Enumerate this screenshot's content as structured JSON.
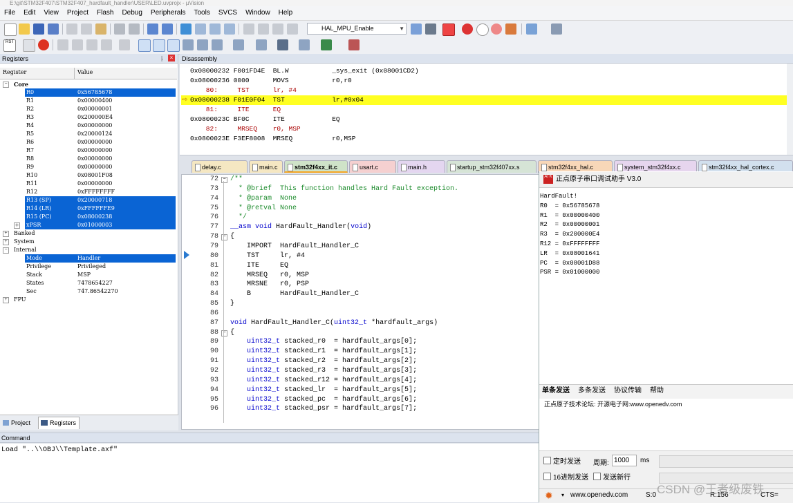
{
  "window": {
    "title": "E:\\git\\STM32F407\\STM32F407_hardfault_handler\\USER\\LED.uvprojx - µVision"
  },
  "menu": [
    "File",
    "Edit",
    "View",
    "Project",
    "Flash",
    "Debug",
    "Peripherals",
    "Tools",
    "SVCS",
    "Window",
    "Help"
  ],
  "toolbar": {
    "target": "HAL_MPU_Enable"
  },
  "registers": {
    "panel_title": "Registers",
    "col_register": "Register",
    "col_value": "Value",
    "core_label": "Core",
    "core": [
      {
        "name": "R0",
        "value": "0x56785678",
        "selected": true
      },
      {
        "name": "R1",
        "value": "0x00000400",
        "selected": false
      },
      {
        "name": "R2",
        "value": "0x00000001",
        "selected": false
      },
      {
        "name": "R3",
        "value": "0x200000E4",
        "selected": false
      },
      {
        "name": "R4",
        "value": "0x00000000",
        "selected": false
      },
      {
        "name": "R5",
        "value": "0x20000124",
        "selected": false
      },
      {
        "name": "R6",
        "value": "0x00000000",
        "selected": false
      },
      {
        "name": "R7",
        "value": "0x00000000",
        "selected": false
      },
      {
        "name": "R8",
        "value": "0x00000000",
        "selected": false
      },
      {
        "name": "R9",
        "value": "0x00000000",
        "selected": false
      },
      {
        "name": "R10",
        "value": "0x08001F08",
        "selected": false
      },
      {
        "name": "R11",
        "value": "0x00000000",
        "selected": false
      },
      {
        "name": "R12",
        "value": "0xFFFFFFFF",
        "selected": false
      },
      {
        "name": "R13 (SP)",
        "value": "0x20000718",
        "selected": true
      },
      {
        "name": "R14 (LR)",
        "value": "0xFFFFFFE9",
        "selected": true
      },
      {
        "name": "R15 (PC)",
        "value": "0x08000238",
        "selected": true
      },
      {
        "name": "xPSR",
        "value": "0x01000003",
        "selected": true
      }
    ],
    "banked_label": "Banked",
    "system_label": "System",
    "internal_label": "Internal",
    "internal": [
      {
        "name": "Mode",
        "value": "Handler",
        "selected": true
      },
      {
        "name": "Privilege",
        "value": "Privileged",
        "selected": false
      },
      {
        "name": "Stack",
        "value": "MSP",
        "selected": false
      },
      {
        "name": "States",
        "value": "7478654227",
        "selected": false
      },
      {
        "name": "Sec",
        "value": "747.86542270",
        "selected": false
      }
    ],
    "fpu_label": "FPU"
  },
  "disassembly": {
    "panel_title": "Disassembly",
    "lines": [
      {
        "text": "0x08000232 F001FD4E  BL.W           _sys_exit (0x08001CD2)",
        "type": "asm"
      },
      {
        "text": "0x08000236 0000      MOVS           r0,r0",
        "type": "asm"
      },
      {
        "text": "    80:     TST      lr, #4",
        "type": "src"
      },
      {
        "text": "0x08000238 F01E0F04  TST            lr,#0x04",
        "type": "cur"
      },
      {
        "text": "    81:     ITE      EQ",
        "type": "src"
      },
      {
        "text": "0x0800023C BF0C      ITE            EQ",
        "type": "asm"
      },
      {
        "text": "    82:     MRSEQ    r0, MSP",
        "type": "src"
      },
      {
        "text": "0x0800023E F3EF8008  MRSEQ          r0,MSP",
        "type": "asm"
      }
    ]
  },
  "tabs": [
    {
      "label": "delay.c",
      "color": "#f5e7c2"
    },
    {
      "label": "main.c",
      "color": "#f5e7c2"
    },
    {
      "label": "stm32f4xx_it.c",
      "color": "#cfe3c8",
      "active": true
    },
    {
      "label": "usart.c",
      "color": "#f5d0d0"
    },
    {
      "label": "main.h",
      "color": "#e4d6f0"
    },
    {
      "label": "startup_stm32f407xx.s",
      "color": "#d6e4d6"
    },
    {
      "label": "stm32f4xx_hal.c",
      "color": "#f8d7b8"
    },
    {
      "label": "system_stm32f4xx.c",
      "color": "#e6d5ee"
    },
    {
      "label": "stm32f4xx_hal_cortex.c",
      "color": "#d2e0ee"
    }
  ],
  "editor": {
    "lines": [
      {
        "n": "72",
        "code": "/**"
      },
      {
        "n": "73",
        "code": "  * @brief  This function handles Hard Fault exception."
      },
      {
        "n": "74",
        "code": "  * @param  None"
      },
      {
        "n": "75",
        "code": "  * @retval None"
      },
      {
        "n": "76",
        "code": "  */"
      },
      {
        "n": "77",
        "code": "__asm void HardFault_Handler(void)"
      },
      {
        "n": "78",
        "code": "{"
      },
      {
        "n": "79",
        "code": "    IMPORT  HardFault_Handler_C"
      },
      {
        "n": "80",
        "code": "    TST     lr, #4"
      },
      {
        "n": "81",
        "code": "    ITE     EQ"
      },
      {
        "n": "82",
        "code": "    MRSEQ   r0, MSP"
      },
      {
        "n": "83",
        "code": "    MRSNE   r0, PSP"
      },
      {
        "n": "84",
        "code": "    B       HardFault_Handler_C"
      },
      {
        "n": "85",
        "code": "}"
      },
      {
        "n": "86",
        "code": ""
      },
      {
        "n": "87",
        "code": "void HardFault_Handler_C(uint32_t *hardfault_args)"
      },
      {
        "n": "88",
        "code": "{"
      },
      {
        "n": "89",
        "code": "    uint32_t stacked_r0  = hardfault_args[0];"
      },
      {
        "n": "90",
        "code": "    uint32_t stacked_r1  = hardfault_args[1];"
      },
      {
        "n": "91",
        "code": "    uint32_t stacked_r2  = hardfault_args[2];"
      },
      {
        "n": "92",
        "code": "    uint32_t stacked_r3  = hardfault_args[3];"
      },
      {
        "n": "93",
        "code": "    uint32_t stacked_r12 = hardfault_args[4];"
      },
      {
        "n": "94",
        "code": "    uint32_t stacked_lr  = hardfault_args[5];"
      },
      {
        "n": "95",
        "code": "    uint32_t stacked_pc  = hardfault_args[6];"
      },
      {
        "n": "96",
        "code": "    uint32_t stacked_psr = hardfault_args[7];"
      }
    ]
  },
  "serial": {
    "title": "正点原子串口调试助手 V3.0",
    "output": [
      "HardFault!",
      "R0  = 0x56785678",
      "R1  = 0x00000400",
      "R2  = 0x00000001",
      "R3  = 0x200000E4",
      "R12 = 0xFFFFFFFF",
      "LR  = 0x08001641",
      "PC  = 0x08001D88",
      "PSR = 0x01000000"
    ],
    "tabs": [
      "单条发送",
      "多条发送",
      "协议传输",
      "帮助"
    ],
    "send_text": "正点原子技术论坛: 开源电子网:www.openedv.com",
    "timed_send": "定时发送",
    "period_label": "周期:",
    "period_value": "1000",
    "period_unit": "ms",
    "hex_send": "16进制发送",
    "newline_send": "发送新行",
    "url": "www.openedv.com",
    "s_count": "S:0",
    "r_count": "R:156",
    "cts": "CTS="
  },
  "bottom": {
    "project_tab": "Project",
    "registers_tab": "Registers",
    "command_title": "Command",
    "command_output": "Load \"..\\\\OBJ\\\\Template.axf\""
  },
  "watermark": "CSDN @王者级废铁"
}
